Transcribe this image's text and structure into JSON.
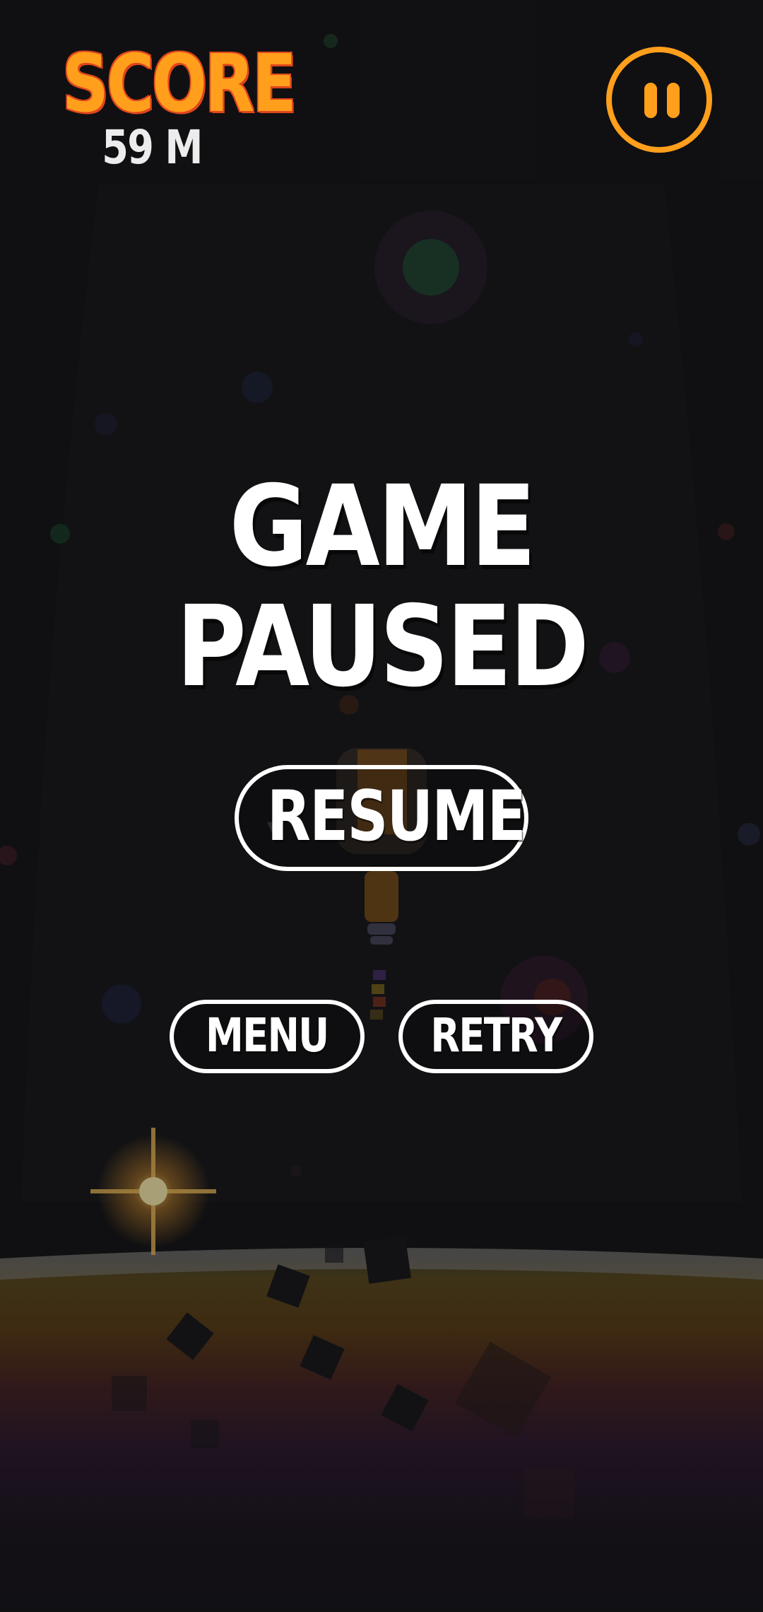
{
  "hud": {
    "score_label": "SCORE",
    "score_value": "59 M",
    "pause_icon": "pause-icon"
  },
  "overlay": {
    "title": "GAME PAUSED",
    "resume_label": "RESUME",
    "menu_label": "MENU",
    "retry_label": "RETRY"
  },
  "colors": {
    "background": "#141416",
    "accent": "#ff9f1c",
    "accent_shadow": "#e0451c",
    "button_border": "#ffffff",
    "text": "#ffffff"
  }
}
